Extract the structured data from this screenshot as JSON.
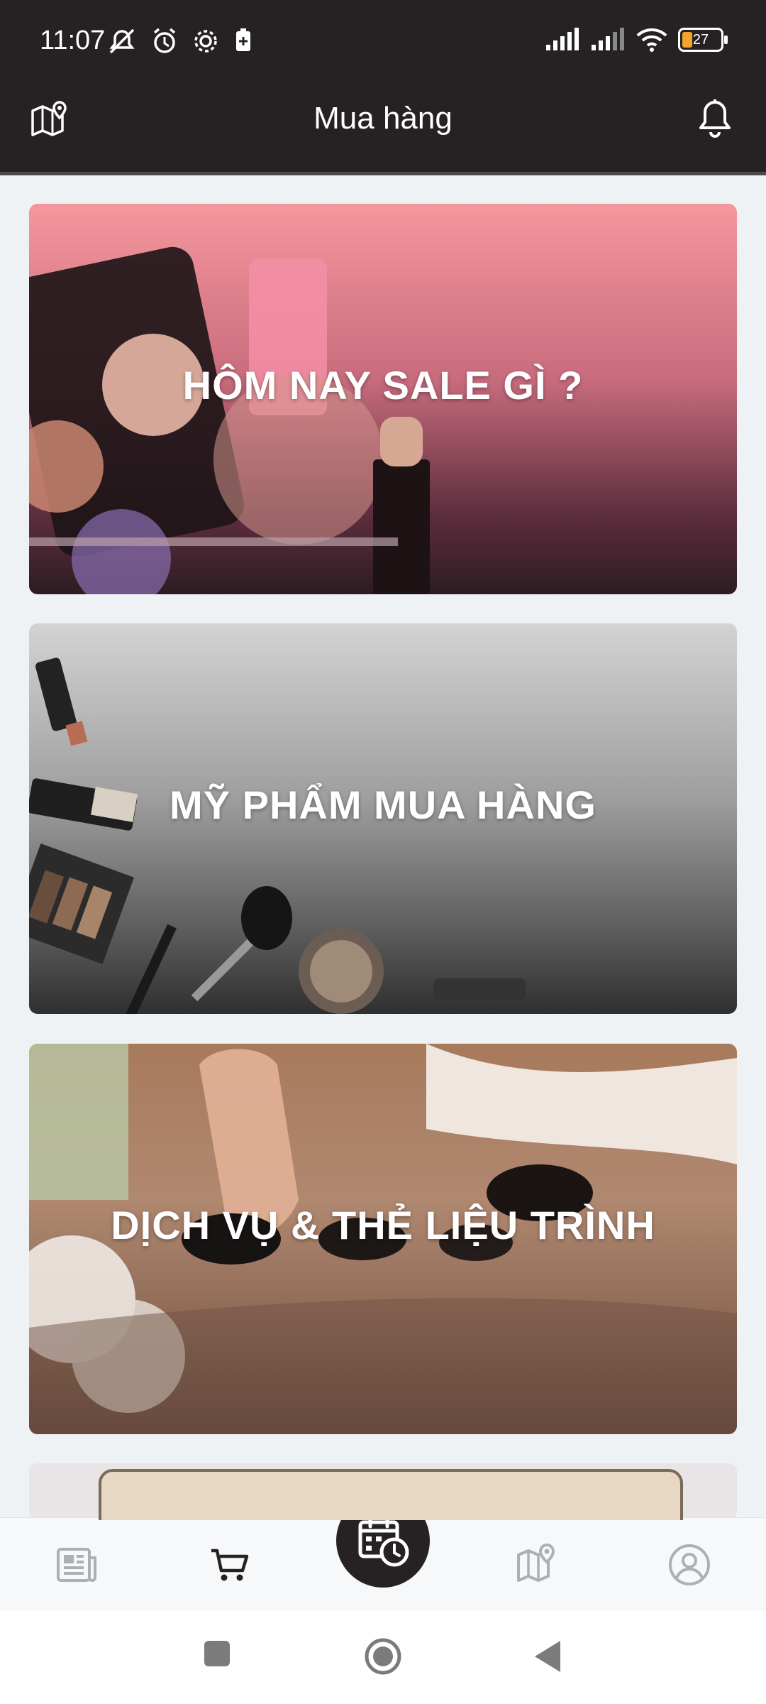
{
  "status_bar": {
    "time": "11:07",
    "battery": "27",
    "icons": [
      "mute-icon",
      "alarm-icon",
      "gear-icon",
      "battery-saver-icon",
      "signal-icon",
      "signal-icon",
      "wifi-icon",
      "battery-icon"
    ]
  },
  "header": {
    "title": "Mua hàng",
    "left_icon": "map-pin-icon",
    "right_icon": "bell-icon"
  },
  "cards": [
    {
      "label": "HÔM NAY SALE GÌ ?"
    },
    {
      "label": "MỸ PHẨM MUA HÀNG"
    },
    {
      "label": "DỊCH VỤ & THẺ LIỆU TRÌNH"
    }
  ],
  "bottom_nav": {
    "items": [
      "news-icon",
      "cart-icon",
      "calendar-clock-icon",
      "map-pin-icon",
      "account-icon"
    ],
    "active": "cart-icon"
  },
  "colors": {
    "bar": "#262223",
    "background": "#eef2f5",
    "battery_fill": "#f3a42c"
  }
}
